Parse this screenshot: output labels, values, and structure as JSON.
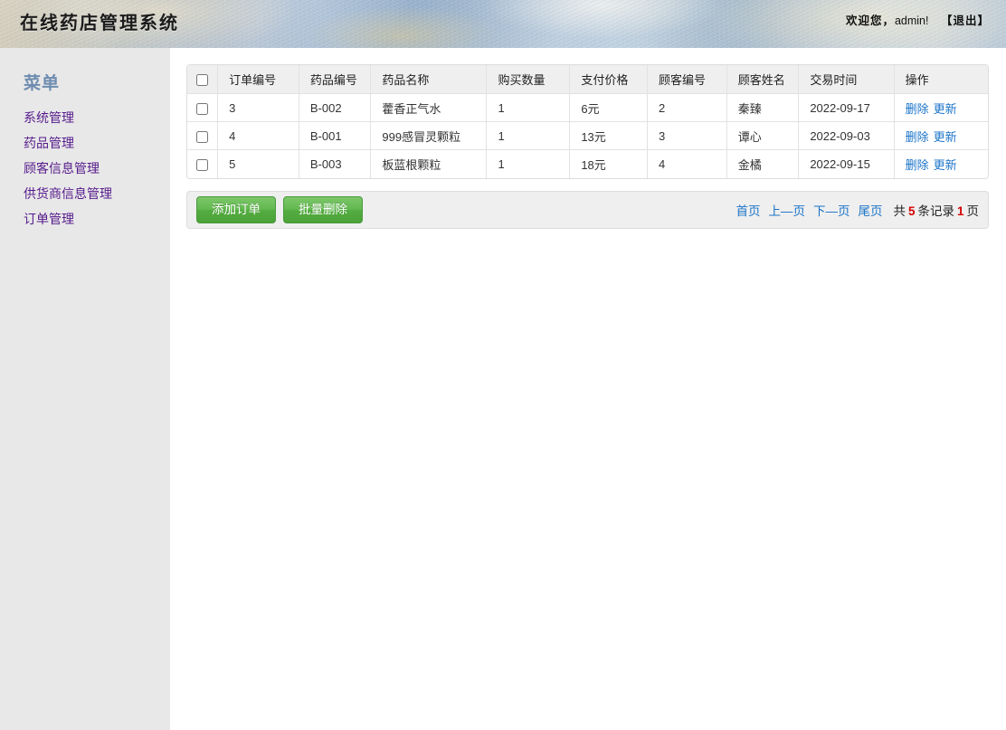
{
  "header": {
    "site_title": "在线药店管理系统",
    "welcome_prefix": "欢迎您，",
    "username": "admin!",
    "logout_label": "【退出】"
  },
  "sidebar": {
    "heading": "菜单",
    "items": [
      {
        "label": "系统管理",
        "name": "sidebar-item-system-management"
      },
      {
        "label": "药品管理",
        "name": "sidebar-item-drug-management"
      },
      {
        "label": "顾客信息管理",
        "name": "sidebar-item-customer-info-management"
      },
      {
        "label": "供货商信息管理",
        "name": "sidebar-item-supplier-info-management"
      },
      {
        "label": "订单管理",
        "name": "sidebar-item-order-management"
      }
    ]
  },
  "table": {
    "columns": [
      "订单编号",
      "药品编号",
      "药品名称",
      "购买数量",
      "支付价格",
      "顾客编号",
      "顾客姓名",
      "交易时间",
      "操作"
    ],
    "rows": [
      {
        "order_no": "3",
        "drug_no": "B-002",
        "drug_name": "藿香正气水",
        "quantity": "1",
        "price": "6元",
        "customer_no": "2",
        "customer_name": "秦臻",
        "trade_time": "2022-09-17",
        "delete_label": "删除",
        "update_label": "更新"
      },
      {
        "order_no": "4",
        "drug_no": "B-001",
        "drug_name": "999感冒灵颗粒",
        "quantity": "1",
        "price": "13元",
        "customer_no": "3",
        "customer_name": "谭心",
        "trade_time": "2022-09-03",
        "delete_label": "删除",
        "update_label": "更新"
      },
      {
        "order_no": "5",
        "drug_no": "B-003",
        "drug_name": "板蓝根颗粒",
        "quantity": "1",
        "price": "18元",
        "customer_no": "4",
        "customer_name": "金橘",
        "trade_time": "2022-09-15",
        "delete_label": "删除",
        "update_label": "更新"
      }
    ]
  },
  "toolbar": {
    "add_order_label": "添加订单",
    "batch_delete_label": "批量删除"
  },
  "pagination": {
    "first_label": "首页",
    "prev_label": "上—页",
    "next_label": "下—页",
    "last_label": "尾页",
    "total_prefix": "共",
    "total_count": "5",
    "records_label": "条记录",
    "page_count": "1",
    "page_label": "页"
  },
  "colors": {
    "menu_link": "#551a8b",
    "menu_heading": "#6e8cb0",
    "action_link": "#1a73c8",
    "button_green": "#5bb248",
    "pager_highlight": "#d40000"
  }
}
